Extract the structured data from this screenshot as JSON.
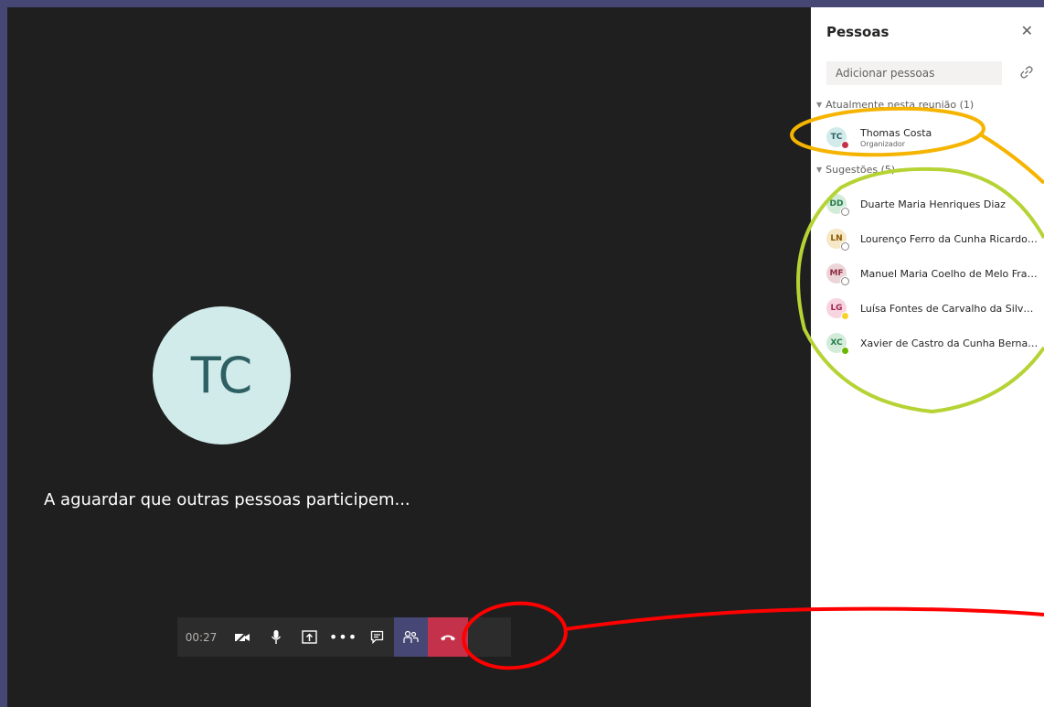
{
  "stage": {
    "avatar_initials": "TC",
    "waiting_text": "A aguardar que outras pessoas participem..."
  },
  "toolbar": {
    "timer": "00:27",
    "camera_icon": "camera-off-icon",
    "mic_icon": "microphone-icon",
    "share_icon": "share-screen-icon",
    "more_icon": "more-options-icon",
    "chat_icon": "chat-icon",
    "participants_icon": "participants-icon",
    "hangup_icon": "hang-up-icon",
    "hangup_color": "#c4314b",
    "active_color": "#464775"
  },
  "panel": {
    "title": "Pessoas",
    "add_placeholder": "Adicionar pessoas",
    "in_meeting_header": "Atualmente nesta reunião (1)",
    "suggestions_header": "Sugestões (5)",
    "in_meeting": [
      {
        "initials": "TC",
        "name": "Thomas Costa",
        "role": "Organizador",
        "status": "busy"
      }
    ],
    "suggestions": [
      {
        "initials": "DD",
        "name": "Duarte Maria Henriques Diaz",
        "status": "offline"
      },
      {
        "initials": "LN",
        "name": "Lourenço Ferro da Cunha Ricardo N...",
        "status": "offline"
      },
      {
        "initials": "MF",
        "name": "Manuel Maria Coelho de Melo Franco",
        "status": "offline"
      },
      {
        "initials": "LG",
        "name": "Luísa Fontes de Carvalho da Silveira ...",
        "status": "away"
      },
      {
        "initials": "XC",
        "name": "Xavier de Castro da Cunha Bernarde...",
        "status": "available"
      }
    ]
  },
  "colors": {
    "busy": "#c4314b",
    "away": "#f8d22a",
    "available": "#6bb700",
    "offline": "#ffffff",
    "annotation_orange": "#f5b400",
    "annotation_green": "#b5d334",
    "annotation_red": "#ff0000"
  }
}
